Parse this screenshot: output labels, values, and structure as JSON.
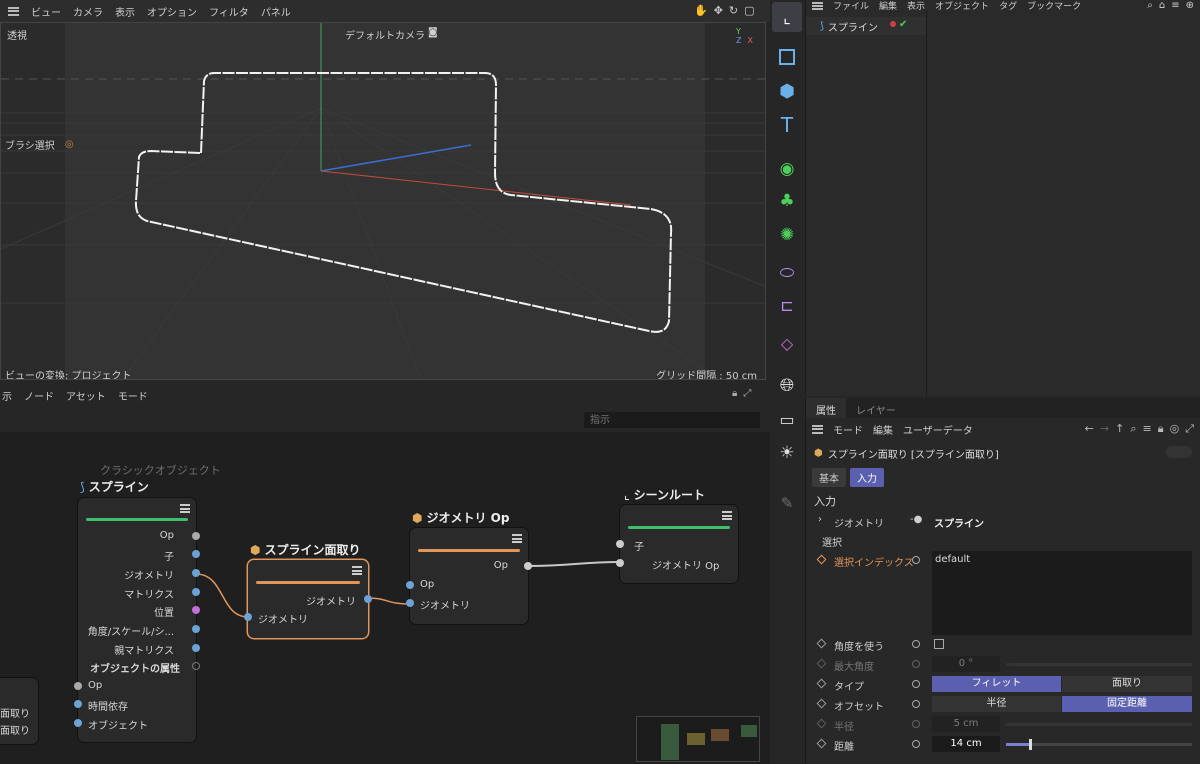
{
  "viewport": {
    "menu": [
      "ビュー",
      "カメラ",
      "表示",
      "オプション",
      "フィルタ",
      "パネル"
    ],
    "view_name": "透視",
    "camera": "デフォルトカメラ",
    "brush_label": "ブラシ選択",
    "transform_label": "ビューの変換: プロジェクト",
    "grid_label": "グリッド間隔 : 50 cm",
    "axis_x": "X",
    "axis_y": "Y",
    "axis_z": "Z"
  },
  "object_manager": {
    "menu": [
      "ファイル",
      "編集",
      "表示",
      "オブジェクト",
      "タグ",
      "ブックマーク"
    ],
    "object_name": "スプライン"
  },
  "node_editor": {
    "menu": [
      "示",
      "ノード",
      "アセット",
      "モード"
    ],
    "search_placeholder": "指示",
    "group_label": "クラシックオブジェクト",
    "spline_node": {
      "title": "スプライン",
      "ports": [
        "Op",
        "子",
        "ジオメトリ",
        "マトリクス",
        "位置",
        "角度/スケール/シ...",
        "親マトリクス",
        "オブジェクトの属性"
      ],
      "inputs": [
        "Op",
        "時間依存",
        "オブジェクト"
      ]
    },
    "chamfer_node": {
      "title": "スプライン面取り",
      "output": "ジオメトリ",
      "input": "ジオメトリ"
    },
    "geomop_node": {
      "title": "ジオメトリ Op",
      "output": "Op",
      "in1": "Op",
      "in2": "ジオメトリ"
    },
    "sceneroot_node": {
      "title": "シーンルート",
      "in1": "子",
      "in2": "ジオメトリ Op"
    },
    "left_partial": [
      "面取り",
      "面取り"
    ]
  },
  "attributes": {
    "tabs": [
      "属性",
      "レイヤー"
    ],
    "menu": [
      "モード",
      "編集",
      "ユーザーデータ"
    ],
    "object_title": "スプライン面取り [スプライン面取り]",
    "subtabs": [
      "基本",
      "入力"
    ],
    "section": "入力",
    "geometry_label": "ジオメトリ",
    "geometry_value": "スプライン",
    "selection_label": "選択",
    "sel_index_label": "選択インデックス",
    "sel_index_value": "default",
    "use_angle_label": "角度を使う",
    "max_angle_label": "最大角度",
    "max_angle_value": "0 °",
    "type_label": "タイプ",
    "type_options": [
      "フィレット",
      "面取り"
    ],
    "offset_label": "オフセット",
    "offset_options": [
      "半径",
      "固定距離"
    ],
    "radius_label": "半径",
    "radius_value": "5 cm",
    "distance_label": "距離",
    "distance_value": "14 cm"
  },
  "colors": {
    "accent": "#5a5fb0",
    "orange_label": "#e0955a",
    "green": "#3fbf6e"
  }
}
